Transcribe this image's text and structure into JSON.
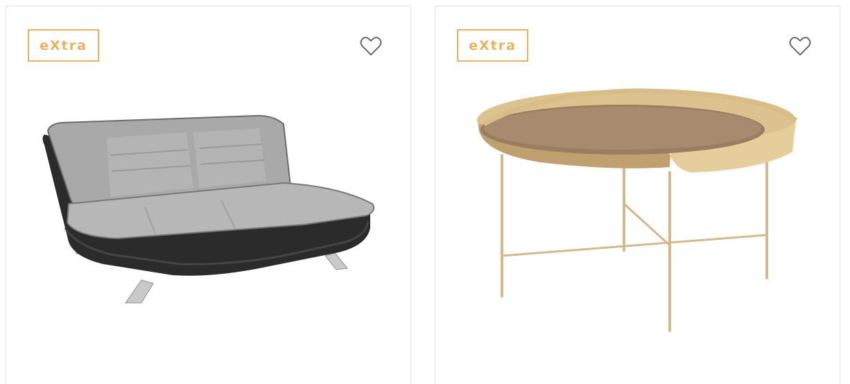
{
  "products": [
    {
      "badge": "eXtra",
      "image_icon": "sofa-bed-grey",
      "favorite_icon": "heart-outline-icon"
    },
    {
      "badge": "eXtra",
      "image_icon": "round-coffee-table-gold",
      "favorite_icon": "heart-outline-icon"
    }
  ],
  "colors": {
    "badge_accent": "#e8b35a",
    "card_border": "#e2e2e2",
    "heart_stroke": "#6b6b6b"
  }
}
